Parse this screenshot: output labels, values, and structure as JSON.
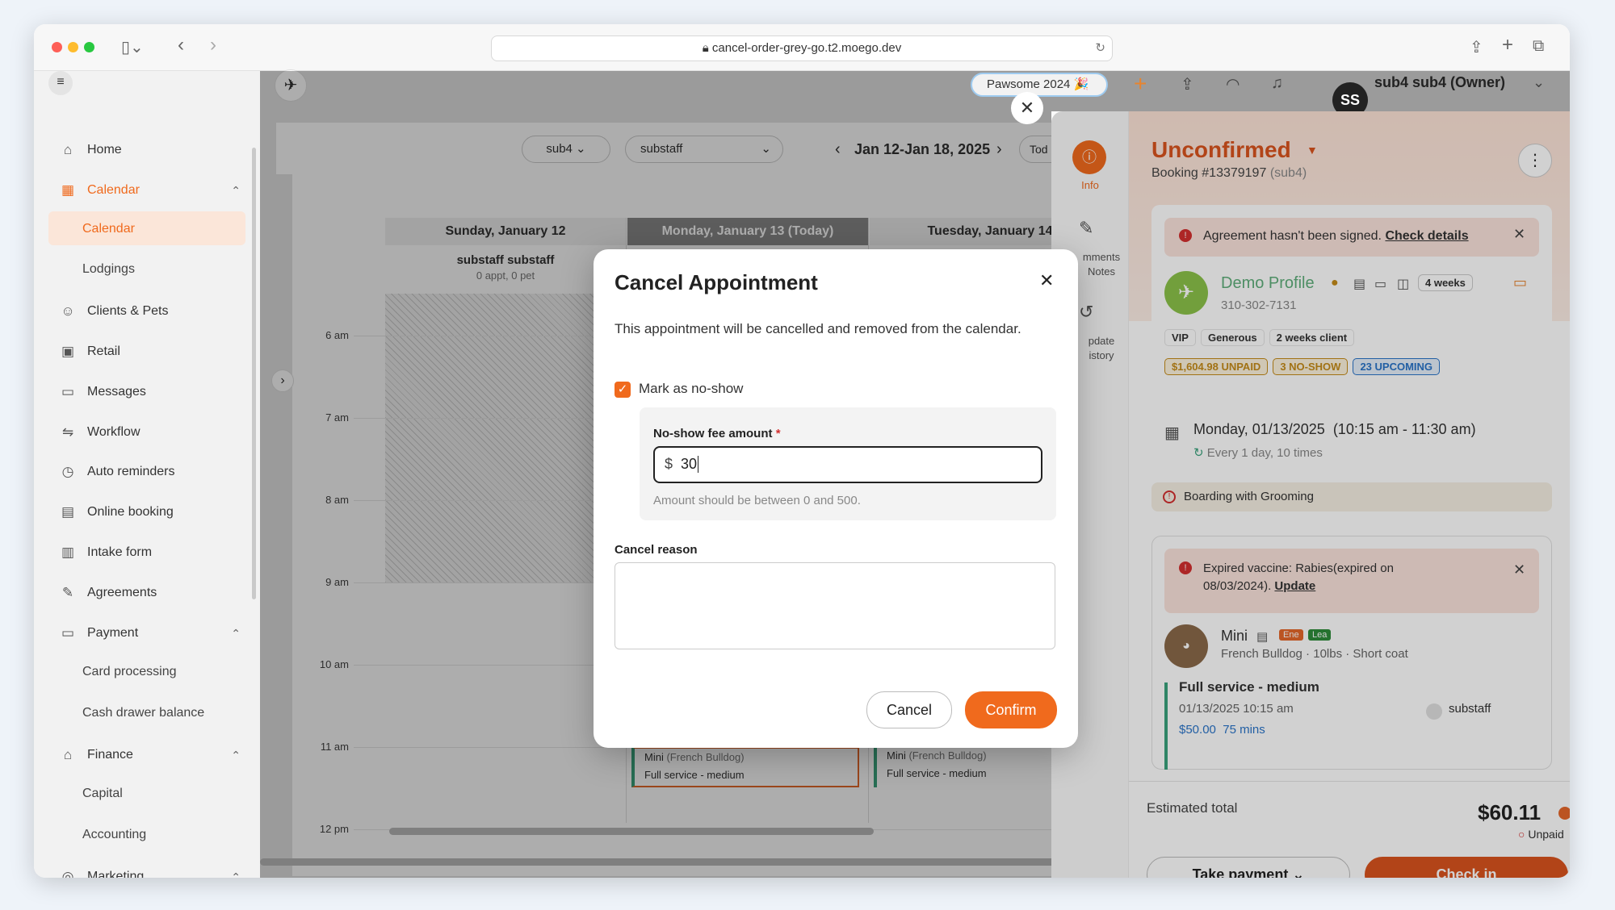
{
  "browser": {
    "url": "cancel-order-grey-go.t2.moego.dev"
  },
  "sidebar": {
    "items": [
      {
        "label": "Home",
        "icon": "home-icon",
        "glyph": "⌂"
      },
      {
        "label": "Calendar",
        "icon": "calendar-icon",
        "glyph": "▦"
      },
      {
        "label": "Calendar"
      },
      {
        "label": "Lodgings"
      },
      {
        "label": "Clients & Pets",
        "icon": "clients-icon",
        "glyph": "☺"
      },
      {
        "label": "Retail",
        "icon": "retail-icon",
        "glyph": "▣"
      },
      {
        "label": "Messages",
        "icon": "messages-icon",
        "glyph": "▭"
      },
      {
        "label": "Workflow",
        "icon": "workflow-icon",
        "glyph": "⇋"
      },
      {
        "label": "Auto reminders",
        "icon": "clock-icon",
        "glyph": "◷"
      },
      {
        "label": "Online booking",
        "icon": "booking-icon",
        "glyph": "▤"
      },
      {
        "label": "Intake form",
        "icon": "form-icon",
        "glyph": "▥"
      },
      {
        "label": "Agreements",
        "icon": "pen-icon",
        "glyph": "✎"
      },
      {
        "label": "Payment",
        "icon": "payment-icon",
        "glyph": "▭"
      },
      {
        "label": "Card processing"
      },
      {
        "label": "Cash drawer balance"
      },
      {
        "label": "Finance",
        "icon": "finance-icon",
        "glyph": "⌂"
      },
      {
        "label": "Capital"
      },
      {
        "label": "Accounting"
      },
      {
        "label": "Marketing",
        "icon": "marketing-icon",
        "glyph": "◎"
      }
    ]
  },
  "topbar": {
    "promo": "Pawsome 2024 🎉",
    "user": "sub4 sub4 (Owner)",
    "avatar": "SS",
    "badge": "..."
  },
  "calendar": {
    "filters": {
      "business": "sub4",
      "staff": "substaff"
    },
    "range": "Jan 12-Jan 18, 2025",
    "today_label": "Tod",
    "columns": [
      {
        "date": "Sunday, January 12",
        "staff": "substaff substaff",
        "meta": "0 appt, 0 pet"
      },
      {
        "date": "Monday, January 13 (Today)"
      },
      {
        "date": "Tuesday, January 14"
      }
    ],
    "times": [
      "6 am",
      "7 am",
      "8 am",
      "9 am",
      "10 am",
      "11 am",
      "12 pm"
    ],
    "appts": [
      {
        "pet": "Mini",
        "breed": "(French Bulldog)",
        "service": "Full service - medium"
      },
      {
        "pet": "Mini",
        "breed": "(French Bulldog)",
        "service": "Full service - medium"
      }
    ]
  },
  "dialog": {
    "title": "Cancel Appointment",
    "description": "This appointment will be cancelled and removed from the calendar.",
    "checkbox_label": "Mark as no-show",
    "fee_label": "No-show fee amount",
    "required_mark": "*",
    "currency": "$",
    "fee_value": "30",
    "hint": "Amount should be between 0 and 500.",
    "reason_label": "Cancel reason",
    "reason_value": "",
    "cancel": "Cancel",
    "confirm": "Confirm"
  },
  "panel": {
    "rail": [
      {
        "label": "Info"
      },
      {
        "label": "mments",
        "label2": "Notes"
      },
      {
        "label": "pdate",
        "label2": "istory"
      }
    ],
    "status": "Unconfirmed",
    "booking": "Booking #13379197",
    "booking_sub": "(sub4)",
    "alert": "Agreement hasn't been signed.",
    "alert_link": "Check details",
    "client_name": "Demo Profile",
    "client_phone": "310-302-7131",
    "freq": "4 weeks",
    "tags": [
      "VIP",
      "Generous",
      "2 weeks client"
    ],
    "badges": [
      "$1,604.98 UNPAID",
      "3 NO-SHOW",
      "23 UPCOMING"
    ],
    "date": "Monday, 01/13/2025",
    "time": "(10:15 am - 11:30 am)",
    "repeat": "Every 1 day, 10 times",
    "service_type": "Boarding with Grooming",
    "vaccine_alert": "Expired vaccine: Rabies(expired on",
    "vaccine_alert2": "08/03/2024).",
    "vaccine_link": "Update",
    "pet_name": "Mini",
    "pet_tags": [
      "Ene",
      "Lea"
    ],
    "pet_info": "French Bulldog · 10lbs · Short coat",
    "service_name": "Full service - medium",
    "service_date": "01/13/2025 10:15 am",
    "service_staff": "substaff",
    "service_price": "$50.00",
    "service_duration": "75 mins",
    "total_label": "Estimated total",
    "total": "$60.11",
    "unpaid": "Unpaid",
    "take_payment": "Take payment",
    "check_in": "Check in"
  },
  "colors": {
    "accent": "#f06a1d",
    "status": "#d9541e",
    "link": "#2a74c9"
  }
}
